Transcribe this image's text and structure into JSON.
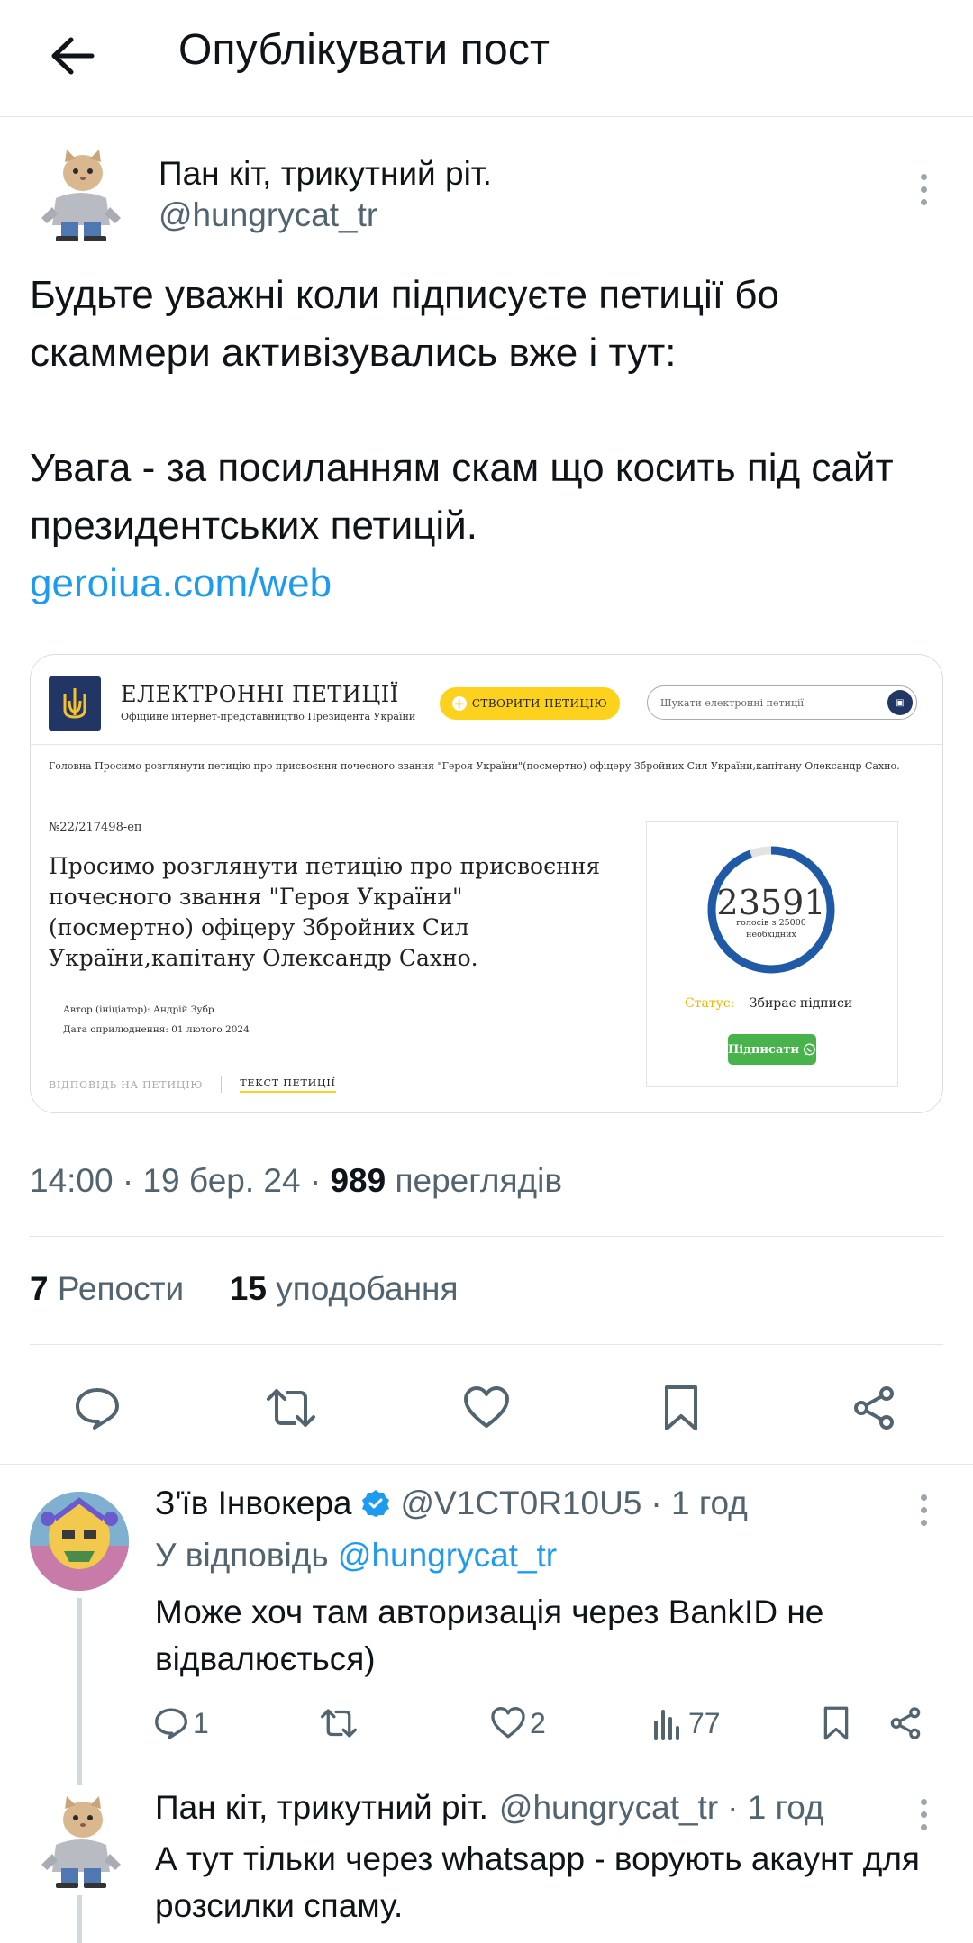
{
  "header": {
    "title": "Опублікувати пост"
  },
  "post": {
    "author_name": "Пан кіт, трикутний ріт.",
    "author_handle": "@hungrycat_tr",
    "text_lines": [
      "Будьте уважні коли підписуєте петиції бо скаммери активізувались вже і тут:",
      "",
      "Увага - за посиланням скам що косить під сайт президентських петицій."
    ],
    "link": "geroiua.com/web",
    "time": "14:00",
    "date": "19 бер. 24",
    "views_count": "989",
    "views_label": "переглядів",
    "reposts_count": "7",
    "reposts_label": "Репости",
    "likes_count": "15",
    "likes_label": "уподобання"
  },
  "card": {
    "site_title": "ЕЛЕКТРОННІ ПЕТИЦІЇ",
    "site_subtitle": "Офіційне інтернет-представництво Президента України",
    "create_button": "СТВОРИТИ ПЕТИЦІЮ",
    "search_placeholder": "Шукати електронні петиції",
    "breadcrumb": "Головна  Просимо розглянути петицію про присвоєння почесного звання \"Героя України\"(посмертно) офіцеру Збройних Сил України,капітану Олександр Сахно.",
    "petition_number": "№22/217498-еп",
    "petition_title": "Просимо розглянути петицію про присвоєння почесного звання \"Героя України\"(посмертно) офіцеру Збройних Сил України,капітану Олександр Сахно.",
    "author_line": "Автор (ініціатор): Андрій Зубр",
    "date_line": "Дата оприлюднення: 01 лютого 2024",
    "tab_answer": "ВІДПОВІДЬ НА ПЕТИЦІЮ",
    "tab_text": "ТЕКСТ ПЕТИЦІЇ",
    "votes": "23591",
    "votes_needed": "голосів з 25000 необхідних",
    "votes_progress_fraction": 0.944,
    "status_label": "Статус:",
    "status_value": "Збирає підписи",
    "sign_button": "Підписати"
  },
  "reply1": {
    "author_name": "З'їв Інвокера",
    "author_handle": "@V1CT0R10U5",
    "time": "· 1 год",
    "replying_prefix": "У відповідь",
    "replying_to": "@hungrycat_tr",
    "text": "Може хоч там авторизація через BankID не відвалюється)",
    "replies": "1",
    "retweets": "",
    "likes": "2",
    "views": "77"
  },
  "reply2": {
    "author_name": "Пан кіт, трикутний ріт.",
    "author_handle": "@hungrycat_tr",
    "time": "· 1 год",
    "text": "А тут тільки через whatsapp - ворують акаунт для розсилки спаму."
  },
  "colors": {
    "link": "#1d9bf0",
    "secondary_text": "#536471",
    "verified": "#1d9bf0",
    "petition_yellow": "#fcd21c",
    "petition_blue": "#223666",
    "sign_green": "#48b24b"
  }
}
